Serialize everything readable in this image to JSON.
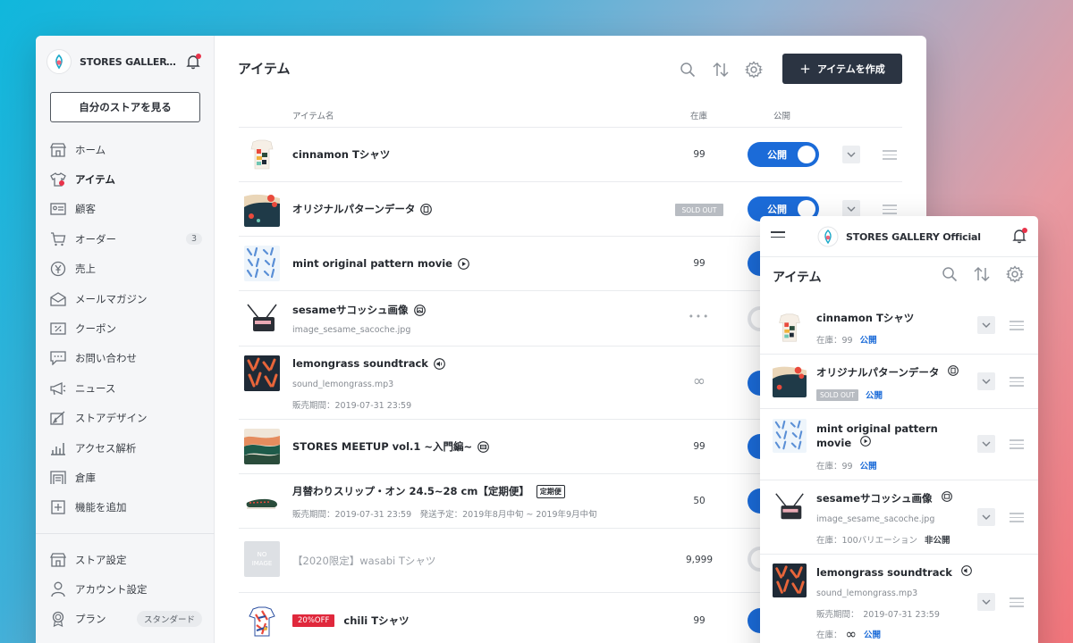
{
  "sidebar": {
    "store_name": "STORES GALLERY Official",
    "view_store_label": "自分のストアを見る",
    "items": [
      {
        "label": "ホーム",
        "icon": "shop-icon"
      },
      {
        "label": "アイテム",
        "icon": "shirt-icon"
      },
      {
        "label": "顧客",
        "icon": "id-card-icon"
      },
      {
        "label": "オーダー",
        "icon": "cart-icon",
        "count": "3"
      },
      {
        "label": "売上",
        "icon": "yen-icon"
      },
      {
        "label": "メールマガジン",
        "icon": "mail-icon"
      },
      {
        "label": "クーポン",
        "icon": "coupon-icon"
      },
      {
        "label": "お問い合わせ",
        "icon": "chat-icon"
      },
      {
        "label": "ニュース",
        "icon": "megaphone-icon"
      },
      {
        "label": "ストアデザイン",
        "icon": "design-icon"
      },
      {
        "label": "アクセス解析",
        "icon": "chart-icon"
      },
      {
        "label": "倉庫",
        "icon": "warehouse-icon"
      },
      {
        "label": "機能を追加",
        "icon": "plus-box-icon"
      }
    ],
    "bottom_items": [
      {
        "label": "ストア設定",
        "icon": "shop-icon"
      },
      {
        "label": "アカウント設定",
        "icon": "person-icon"
      },
      {
        "label": "プラン",
        "icon": "medal-icon",
        "badge": "スタンダード"
      }
    ]
  },
  "main": {
    "title": "アイテム",
    "create_button": "アイテムを作成",
    "columns": {
      "name": "アイテム名",
      "stock": "在庫",
      "publish": "公開"
    },
    "publish_label": "公開",
    "rows": [
      {
        "name": "cinnamon Tシャツ",
        "stock": "99"
      },
      {
        "name": "オリジナルパターンデータ",
        "stock": "SOLD OUT"
      },
      {
        "name": "mint original pattern movie",
        "stock": "99"
      },
      {
        "name": "sesameサコッシュ画像",
        "sub": "image_sesame_sacoche.jpg",
        "stock": "•••"
      },
      {
        "name": "lemongrass soundtrack",
        "sub": "sound_lemongrass.mp3",
        "sub2": "販売期間：2019-07-31 23:59",
        "stock": "∞"
      },
      {
        "name": "STORES MEETUP vol.1 ~入門編~",
        "stock": "99"
      },
      {
        "name": "月替わりスリップ・オン 24.5~28 cm【定期便】",
        "tag": "定期便",
        "sub": "販売期間：2019-07-31 23:59　発送予定：2019年8月中旬 ~ 2019年9月中旬",
        "stock": "50"
      },
      {
        "name": "【2020限定】wasabi Tシャツ",
        "stock": "9,999",
        "noimage": "NO IMAGE"
      },
      {
        "name": "chili Tシャツ",
        "sale": "20%OFF",
        "stock": "99"
      }
    ]
  },
  "mobile": {
    "store_name": "STORES GALLERY Official",
    "title": "アイテム",
    "rows": [
      {
        "name": "cinnamon Tシャツ",
        "stock_label": "在庫：99",
        "status": "公開"
      },
      {
        "name": "オリジナルパターンデータ",
        "stock_label": "SOLD OUT",
        "status": "公開"
      },
      {
        "name": "mint original pattern movie",
        "stock_label": "在庫：99",
        "status": "公開"
      },
      {
        "name": "sesameサコッシュ画像",
        "file": "image_sesame_sacoche.jpg",
        "stock_label": "在庫：100バリエーション",
        "status": "非公開"
      },
      {
        "name": "lemongrass soundtrack",
        "file": "sound_lemongrass.mp3",
        "period": "販売期間：　2019-07-31 23:59",
        "stock_label": "在庫：",
        "status": "公開"
      }
    ]
  },
  "colors": {
    "accent": "#1b6bd8",
    "create_button": "#2b3442",
    "badge_red": "#e0283c"
  }
}
